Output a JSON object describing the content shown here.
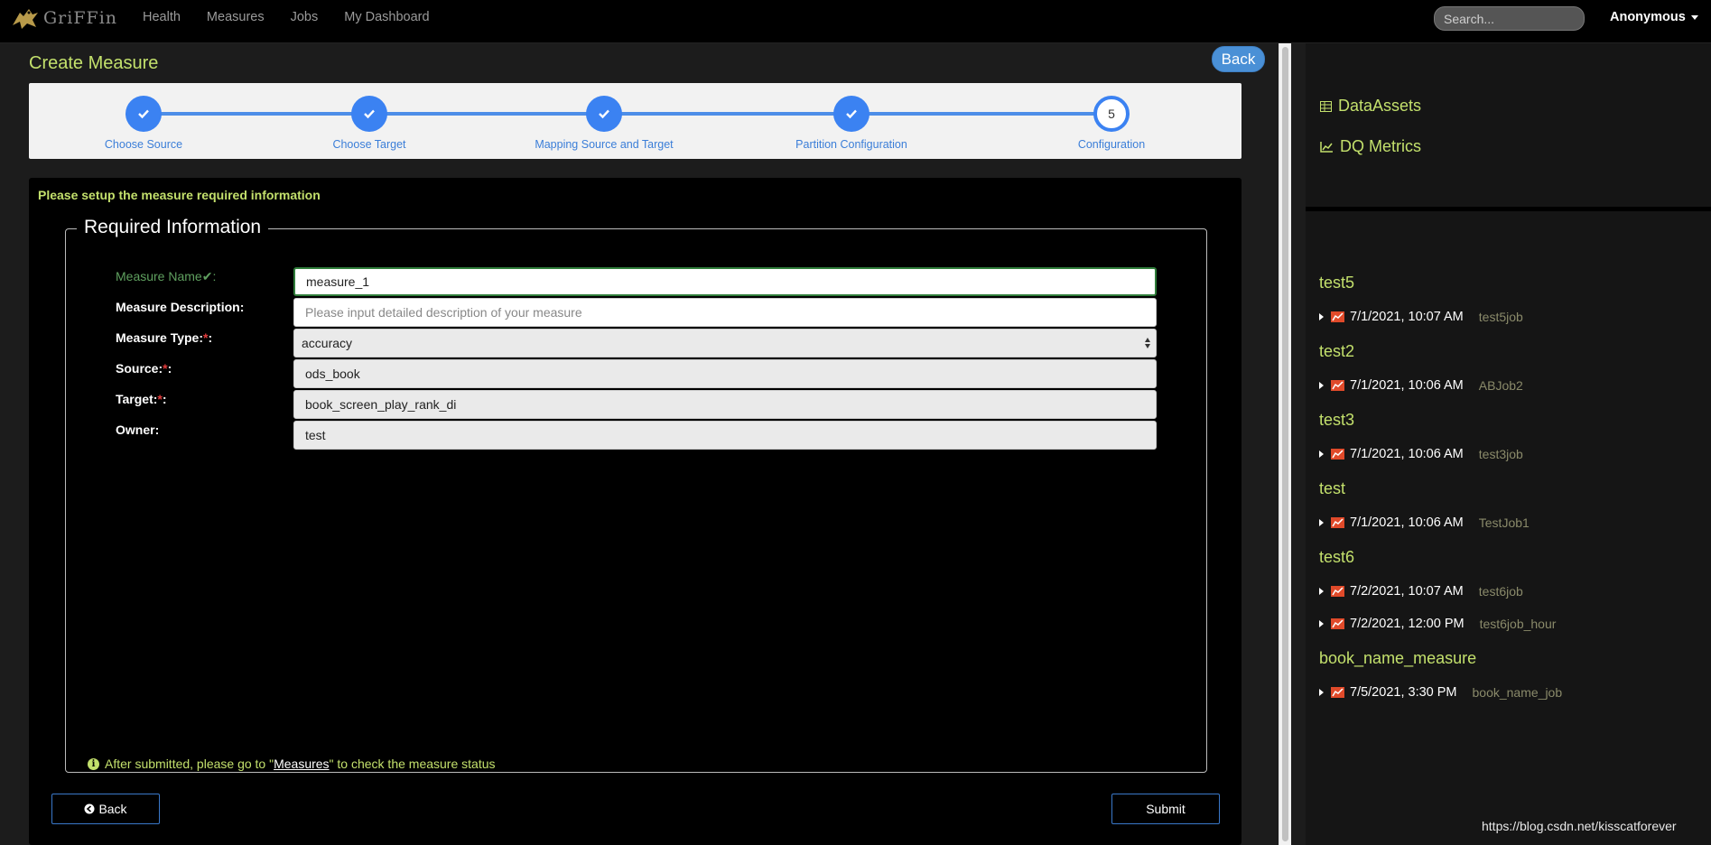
{
  "navbar": {
    "brand": "GriFFin",
    "links": [
      "Health",
      "Measures",
      "Jobs",
      "My Dashboard"
    ],
    "search_placeholder": "Search...",
    "user": "Anonymous"
  },
  "page": {
    "title": "Create Measure",
    "back_top": "Back"
  },
  "stepper": {
    "steps": [
      {
        "label": "Choose Source",
        "state": "done"
      },
      {
        "label": "Choose Target",
        "state": "done"
      },
      {
        "label": "Mapping Source and Target",
        "state": "done"
      },
      {
        "label": "Partition Configuration",
        "state": "done"
      },
      {
        "label": "Configuration",
        "state": "current",
        "number": "5"
      }
    ]
  },
  "form": {
    "instruction": "Please setup the measure required information",
    "legend": "Required Information",
    "fields": [
      {
        "label": "Measure Name",
        "value": "measure_1",
        "required": false,
        "valid": true
      },
      {
        "label": "Measure Description:",
        "placeholder": "Please input detailed description of your measure",
        "value": ""
      },
      {
        "label": "Measure Type:",
        "value": "accuracy",
        "required": true
      },
      {
        "label": "Source:",
        "value": "ods_book",
        "required": true
      },
      {
        "label": "Target:",
        "value": "book_screen_play_rank_di",
        "required": true
      },
      {
        "label": "Owner:",
        "value": "test"
      }
    ],
    "note_before": "After submitted, please go to \"",
    "note_link": "Measures",
    "note_after": "\" to check the measure status",
    "back_button": "Back",
    "submit_button": "Submit"
  },
  "sidebar": {
    "nav": [
      {
        "label": "DataAssets",
        "icon": "table-icon"
      },
      {
        "label": "DQ Metrics",
        "icon": "line-chart-icon"
      }
    ],
    "metrics": [
      {
        "name": "test5",
        "runs": [
          {
            "time": "7/1/2021, 10:07 AM",
            "job": "test5job"
          }
        ]
      },
      {
        "name": "test2",
        "runs": [
          {
            "time": "7/1/2021, 10:06 AM",
            "job": "ABJob2"
          }
        ]
      },
      {
        "name": "test3",
        "runs": [
          {
            "time": "7/1/2021, 10:06 AM",
            "job": "test3job"
          }
        ]
      },
      {
        "name": "test",
        "runs": [
          {
            "time": "7/1/2021, 10:06 AM",
            "job": "TestJob1"
          }
        ]
      },
      {
        "name": "test6",
        "runs": [
          {
            "time": "7/2/2021, 10:07 AM",
            "job": "test6job"
          },
          {
            "time": "7/2/2021, 12:00 PM",
            "job": "test6job_hour"
          }
        ]
      },
      {
        "name": "book_name_measure",
        "runs": [
          {
            "time": "7/5/2021, 3:30 PM",
            "job": "book_name_job"
          }
        ]
      }
    ]
  },
  "watermark": "https://blog.csdn.net/kisscatforever",
  "colors": {
    "accent_green": "#c3e06c",
    "step_blue": "#3b82f2",
    "required_red": "#e23b3b"
  }
}
